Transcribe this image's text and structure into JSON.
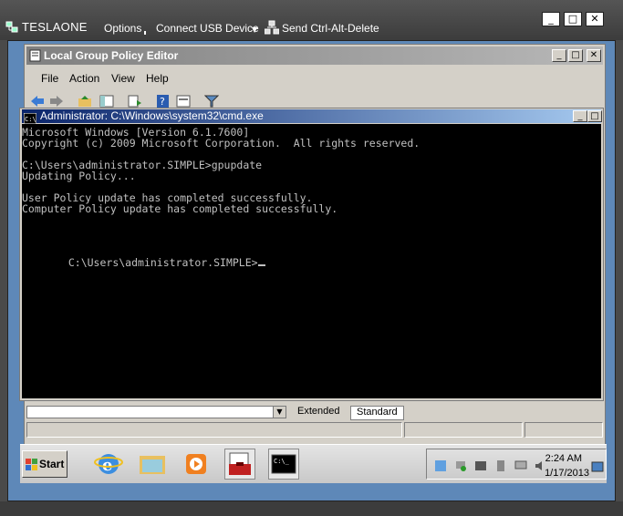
{
  "vm": {
    "title": "TESLAONE",
    "menu": {
      "options": "Options",
      "usb": "Connect USB Device",
      "cad": "Send Ctrl-Alt-Delete"
    },
    "window_buttons": {
      "minimize": "_",
      "maximize": "□",
      "close": "✕"
    }
  },
  "gpe": {
    "title": "Local Group Policy Editor",
    "menu": [
      "File",
      "Action",
      "View",
      "Help"
    ],
    "tabs": [
      "Extended",
      "Standard"
    ],
    "window_buttons": {
      "minimize": "_",
      "maximize": "□",
      "close": "✕"
    }
  },
  "cmd": {
    "title": "Administrator: C:\\Windows\\system32\\cmd.exe",
    "lines": [
      "Microsoft Windows [Version 6.1.7600]",
      "Copyright (c) 2009 Microsoft Corporation.  All rights reserved.",
      "",
      "C:\\Users\\administrator.SIMPLE>gpupdate",
      "Updating Policy...",
      "",
      "User Policy update has completed successfully.",
      "Computer Policy update has completed successfully.",
      "",
      "",
      "C:\\Users\\administrator.SIMPLE>"
    ]
  },
  "taskbar": {
    "start_label": "Start",
    "clock": {
      "time": "2:24 AM",
      "date": "1/17/2013"
    }
  },
  "colors": {
    "desktop": "#5e88b8",
    "cmd_bg": "#000000",
    "cmd_text": "#c0c0c0",
    "title_active": "#0a246a"
  }
}
